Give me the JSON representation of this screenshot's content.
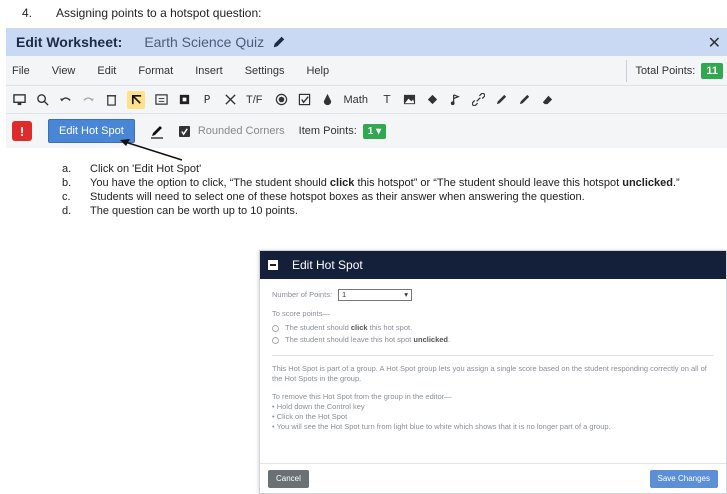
{
  "step": {
    "number": "4.",
    "text": "Assigning points to a hotspot question:"
  },
  "editor": {
    "app_title": "Edit Worksheet:",
    "doc_title": "Earth Science Quiz",
    "close_glyph": "✕",
    "menu": [
      "File",
      "View",
      "Edit",
      "Format",
      "Insert",
      "Settings",
      "Help"
    ],
    "total_points_label": "Total Points:",
    "total_points_value": "11",
    "toolbar": {
      "p_label": "P",
      "tf_label": "T/F",
      "math_label": "Math",
      "t_label": "T"
    },
    "propbar": {
      "alert_glyph": "!",
      "edit_hotspot_label": "Edit Hot Spot",
      "rounded_corners_label": "Rounded Corners",
      "item_points_label": "Item Points:",
      "item_points_value": "1"
    }
  },
  "instructions": [
    {
      "mark": "a.",
      "text": "Click on 'Edit Hot Spot'"
    },
    {
      "mark": "b.",
      "pre": "You have the option to click, “The student should ",
      "bold1": "click",
      "mid": " this hotspot” or “The student should leave this hotspot ",
      "bold2": "unclicked",
      "post": ".”"
    },
    {
      "mark": "c.",
      "text": "Students will need to select one of these hotspot boxes as their answer when answering the question."
    },
    {
      "mark": "d.",
      "text": "The question can be worth up to 10 points."
    }
  ],
  "dialog": {
    "title": "Edit Hot Spot",
    "number_of_points_label": "Number of Points:",
    "number_of_points_value": "1",
    "to_score_label": "To score points—",
    "option1_pre": "The student should ",
    "option1_bold": "click",
    "option1_post": " this hot spot.",
    "option2_pre": "The student should leave this hot spot ",
    "option2_bold": "unclicked",
    "option2_post": ".",
    "group_text": "This Hot Spot is part of a group. A Hot Spot group lets you assign a single score based on the student responding correctly on all of the Hot Spots in the group.",
    "remove_heading": "To remove this Hot Spot from the group in the editor—",
    "remove_steps": [
      "• Hold down the Control key",
      "• Click on the Hot Spot",
      "• You will see the Hot Spot turn from light blue to white which shows that it is no longer part of a group."
    ],
    "cancel_label": "Cancel",
    "save_label": "Save Changes"
  },
  "colors": {
    "titlebar": "#c9d9f4",
    "badge_green": "#2fa84f",
    "alert_red": "#e02b2b",
    "button_blue": "#4a86d6",
    "dialog_header": "#141f3a"
  }
}
